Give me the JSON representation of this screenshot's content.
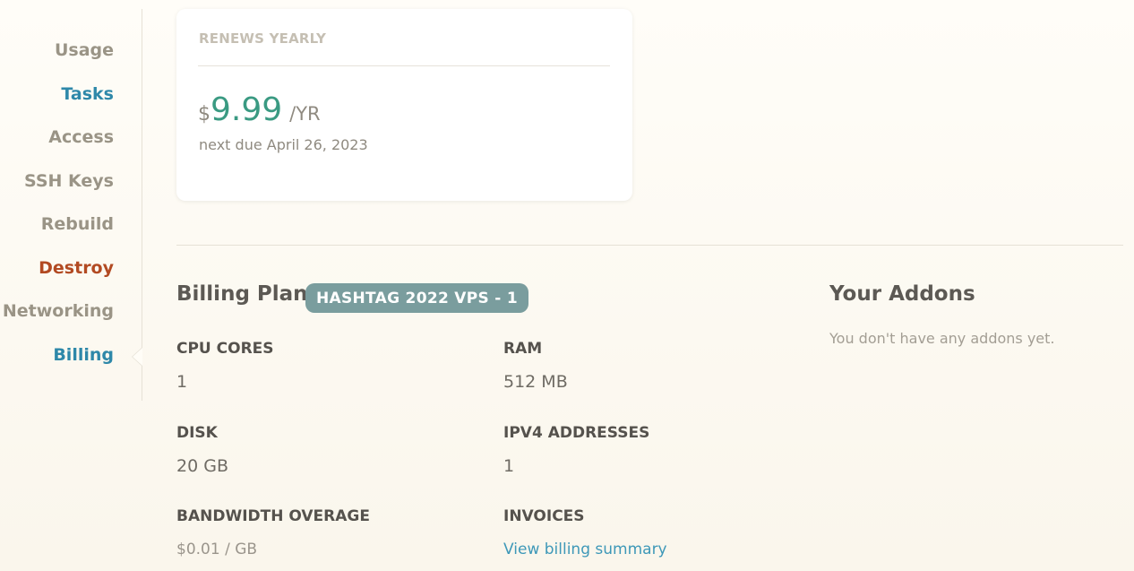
{
  "sidebar": {
    "items": [
      {
        "label": "Usage",
        "color": "#9a9486"
      },
      {
        "label": "Tasks",
        "color": "#2e88a9"
      },
      {
        "label": "Access",
        "color": "#9a9486"
      },
      {
        "label": "SSH Keys",
        "color": "#9a9486"
      },
      {
        "label": "Rebuild",
        "color": "#9a9486"
      },
      {
        "label": "Destroy",
        "color": "#b24a22"
      },
      {
        "label": "Networking",
        "color": "#9a9486"
      },
      {
        "label": "Billing",
        "color": "#2e88a9",
        "active": true
      }
    ]
  },
  "renewal": {
    "heading": "RENEWS YEARLY",
    "currency": "$",
    "amount": "9.99",
    "period": "/YR",
    "next_due": "next due April 26, 2023"
  },
  "billing": {
    "title": "Billing Plan:",
    "plan_name": "HASHTAG 2022 VPS - 1",
    "specs": {
      "cpu_label": "CPU CORES",
      "cpu_value": "1",
      "ram_label": "RAM",
      "ram_value": "512 MB",
      "disk_label": "DISK",
      "disk_value": "20 GB",
      "ipv4_label": "IPV4 ADDRESSES",
      "ipv4_value": "1",
      "bandwidth_label": "BANDWIDTH OVERAGE",
      "bandwidth_value": "$0.01 / GB",
      "invoices_label": "INVOICES",
      "invoices_link": "View billing summary"
    }
  },
  "addons": {
    "title": "Your Addons",
    "empty_text": "You don't have any addons yet."
  },
  "colors": {
    "accent_blue": "#2e88a9",
    "danger": "#b24a22",
    "price_green": "#3a9a82",
    "badge": "#7a9d9e"
  }
}
